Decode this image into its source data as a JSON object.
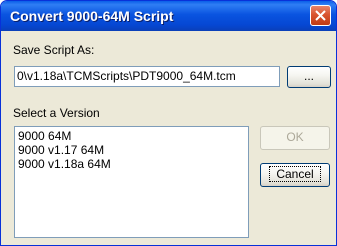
{
  "window": {
    "title": "Convert 9000-64M Script"
  },
  "save": {
    "label": "Save Script As:",
    "path_value": "0\\v1.18a\\TCMScripts\\PDT9000_64M.tcm",
    "browse_label": "..."
  },
  "version": {
    "label": "Select a Version",
    "items": [
      "9000 64M",
      "9000 v1.17 64M",
      "9000 v1.18a 64M"
    ]
  },
  "buttons": {
    "ok_label": "OK",
    "cancel_label": "Cancel"
  },
  "icons": {
    "close": "close-icon"
  }
}
